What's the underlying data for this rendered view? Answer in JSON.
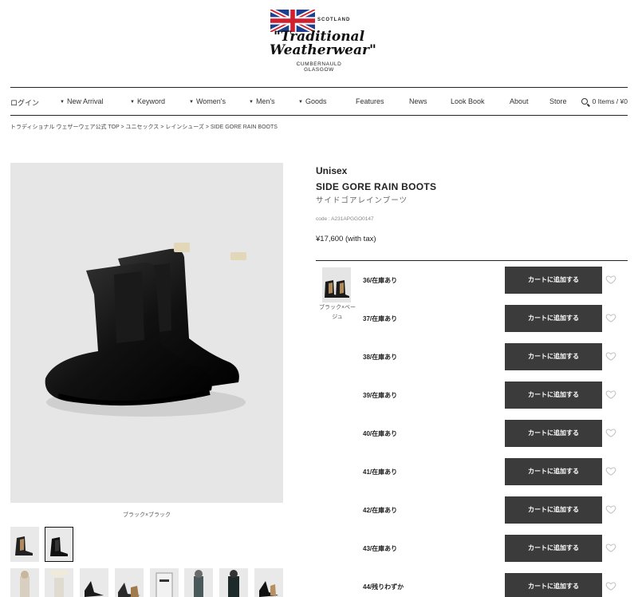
{
  "brand": {
    "scotland": "SCOTLAND",
    "line1": "\"Traditional",
    "line2": "Weatherwear\"",
    "city1": "CUMBERNAULD",
    "city2": "GLASGOW"
  },
  "nav": {
    "login": "ログイン",
    "items": [
      "New Arrival",
      "Keyword",
      "Women's",
      "Men's",
      "Goods",
      "Features",
      "News",
      "Look Book",
      "About",
      "Store"
    ],
    "cart": "0 Items / ¥0"
  },
  "breadcrumb": "トラディショナル ウェザーウェア公式 TOP > ユニセックス > レインシューズ > SIDE GORE RAIN BOOTS",
  "image_caption": "ブラック×ブラック",
  "product": {
    "gender": "Unisex",
    "name": "SIDE GORE RAIN BOOTS",
    "name_jp": "サイドゴアレインブーツ",
    "code": "code : A231APGGO0147",
    "price": "¥17,600 (with tax)"
  },
  "color_option": {
    "name": "ブラック×ベージュ"
  },
  "sizes": [
    {
      "label": "36/在庫あり",
      "button": "カートに追加する"
    },
    {
      "label": "37/在庫あり",
      "button": "カートに追加する"
    },
    {
      "label": "38/在庫あり",
      "button": "カートに追加する"
    },
    {
      "label": "39/在庫あり",
      "button": "カートに追加する"
    },
    {
      "label": "40/在庫あり",
      "button": "カートに追加する"
    },
    {
      "label": "41/在庫あり",
      "button": "カートに追加する"
    },
    {
      "label": "42/在庫あり",
      "button": "カートに追加する"
    },
    {
      "label": "43/在庫あり",
      "button": "カートに追加する"
    },
    {
      "label": "44/残りわずか",
      "button": "カートに追加する"
    }
  ],
  "icons": {
    "search": "search-icon",
    "heart": "heart-icon",
    "caret": "caret-down-icon"
  },
  "colors": {
    "button_bg": "#3b3b3b",
    "flag_blue": "#1f3f8f",
    "flag_red": "#cf2030"
  }
}
